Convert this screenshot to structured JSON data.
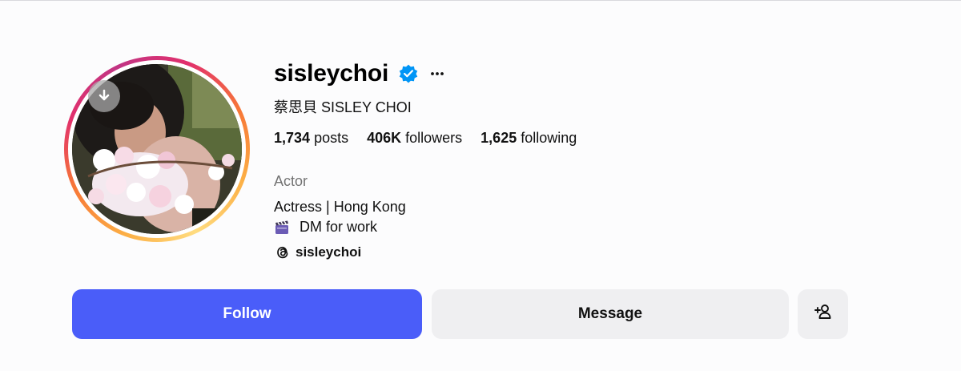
{
  "profile": {
    "username": "sisleychoi",
    "full_name": "蔡思貝 SISLEY CHOI",
    "verified": true
  },
  "stats": {
    "posts_count": "1,734",
    "posts_label": "posts",
    "followers_count": "406K",
    "followers_label": "followers",
    "following_count": "1,625",
    "following_label": "following"
  },
  "bio": {
    "category": "Actor",
    "line1": "Actress | Hong Kong",
    "line2": "DM for work",
    "threads_handle": "sisleychoi"
  },
  "actions": {
    "follow_label": "Follow",
    "message_label": "Message"
  },
  "icons": {
    "verified": "verified-badge-icon",
    "more": "more-options-icon",
    "clapper": "clapper-board-emoji",
    "threads": "threads-logo-icon",
    "add_person": "add-person-icon",
    "download": "download-icon"
  },
  "colors": {
    "follow_button": "#4a5df9",
    "secondary_button": "#efeff1",
    "verified_blue": "#0095f6",
    "muted_text": "#737373"
  }
}
